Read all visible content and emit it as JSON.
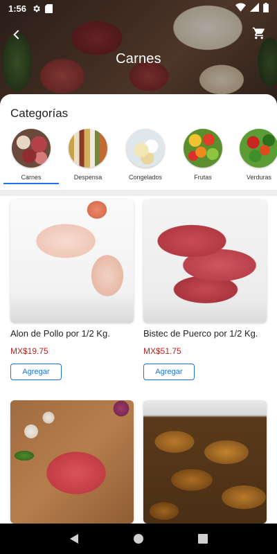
{
  "status_bar": {
    "time": "1:56",
    "icons_left": [
      "gear-icon",
      "sd-card-icon"
    ],
    "icons_right": [
      "wifi-icon",
      "signal-icon",
      "battery-icon"
    ]
  },
  "header": {
    "title": "Carnes",
    "back_icon": "back-arrow-icon",
    "cart_icon": "cart-icon"
  },
  "categories": {
    "title": "Categorías",
    "selected_index": 0,
    "accent_color": "#1a73e8",
    "items": [
      {
        "label": "Carnes",
        "icon": "meat-photo"
      },
      {
        "label": "Despensa",
        "icon": "pantry-photo"
      },
      {
        "label": "Congelados",
        "icon": "frozen-photo"
      },
      {
        "label": "Frutas",
        "icon": "fruits-photo"
      },
      {
        "label": "Verduras",
        "icon": "vegetables-photo"
      }
    ]
  },
  "products": [
    {
      "name": "Alon de Pollo por 1/2 Kg.",
      "price": "MX$19.75",
      "button": "Agregar",
      "image": "chicken-wing-photo"
    },
    {
      "name": "Bistec de Puerco por 1/2 Kg.",
      "price": "MX$51.75",
      "button": "Agregar",
      "image": "pork-steak-photo"
    },
    {
      "name": "",
      "price": "",
      "button": "",
      "image": "beef-slices-photo"
    },
    {
      "name": "",
      "price": "",
      "button": "",
      "image": "roasted-chicken-legs-photo"
    }
  ],
  "colors": {
    "price": "#b3261e",
    "button_border": "#1a73e8",
    "nav_bar": "#000000"
  },
  "nav_bar": {
    "icons": [
      "nav-back-icon",
      "nav-home-icon",
      "nav-recents-icon"
    ]
  }
}
